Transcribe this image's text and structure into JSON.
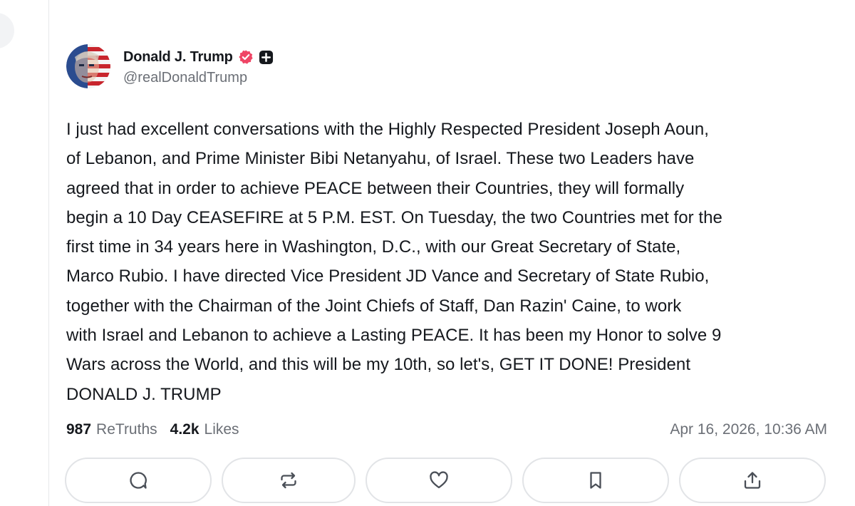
{
  "post": {
    "author": {
      "display_name": "Donald J. Trump",
      "handle": "@realDonaldTrump",
      "verified_icon": "verified-badge-icon",
      "plus_icon": "plus-badge-icon"
    },
    "text": "I just had excellent conversations with the Highly Respected President Joseph Aoun,\nof Lebanon, and Prime Minister Bibi Netanyahu, of Israel. These two Leaders have\nagreed that in order to achieve PEACE between their Countries, they will formally\nbegin a 10 Day CEASEFIRE at 5 P.M. EST. On Tuesday, the two Countries met for the\nfirst time in 34 years here in Washington, D.C., with our Great Secretary of State,\nMarco Rubio. I have directed Vice President JD Vance and Secretary of State Rubio,\ntogether with the Chairman of the Joint Chiefs of Staff, Dan Razin' Caine, to work\nwith Israel and Lebanon to achieve a Lasting PEACE. It has been my Honor to solve 9\nWars across the World, and this will be my 10th, so let's, GET IT DONE! President\nDONALD J. TRUMP",
    "stats": {
      "retruths_count": "987",
      "retruths_label": "ReTruths",
      "likes_count": "4.2k",
      "likes_label": "Likes"
    },
    "timestamp": "Apr 16, 2026, 10:36 AM"
  },
  "actions": [
    {
      "name": "reply",
      "icon": "comment-icon"
    },
    {
      "name": "retruth",
      "icon": "repost-icon"
    },
    {
      "name": "like",
      "icon": "heart-icon"
    },
    {
      "name": "bookmark",
      "icon": "bookmark-icon"
    },
    {
      "name": "share",
      "icon": "share-icon"
    }
  ],
  "colors": {
    "verified": "#ef4565",
    "text": "#15181d",
    "muted": "#6b6f76",
    "border": "#e2e4e7"
  }
}
